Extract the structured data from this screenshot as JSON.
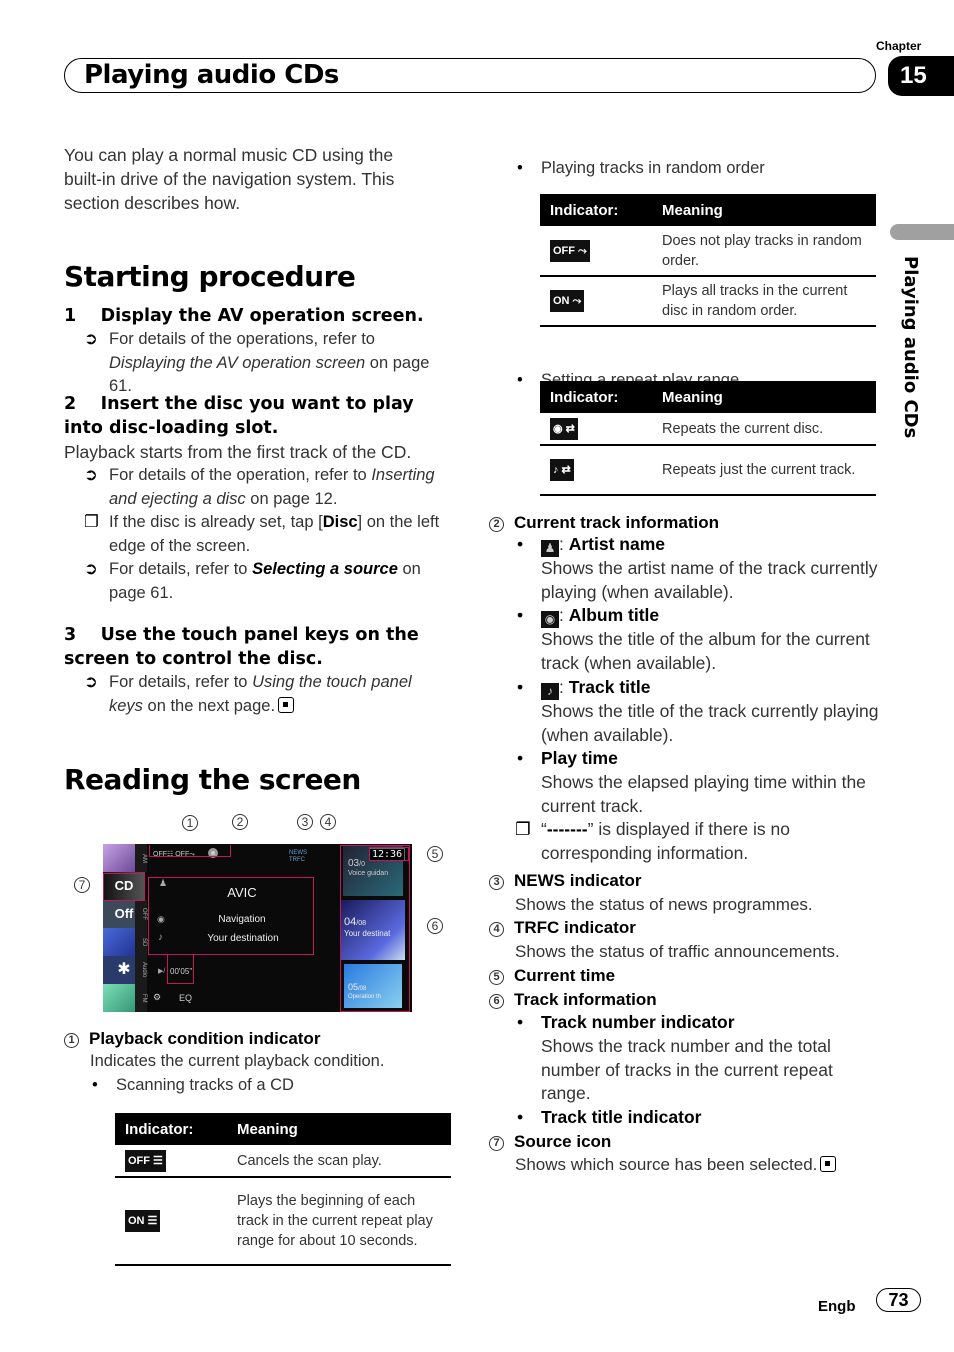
{
  "header": {
    "title": "Playing audio CDs",
    "chapter_label": "Chapter",
    "chapter_number": "15",
    "side_label": "Playing audio CDs"
  },
  "intro": "You can play a normal music CD using the built-in drive of the navigation system. This section describes how.",
  "starting": {
    "heading": "Starting procedure",
    "step1": {
      "num": "1",
      "title": "Display the AV operation screen.",
      "note1_pre": "For details of the operations, refer to ",
      "note1_link": "Displaying the AV operation screen",
      "note1_post": " on page 61."
    },
    "step2": {
      "num": "2",
      "title": "Insert the disc you want to play into disc-loading slot.",
      "body": "Playback starts from the first track of the CD.",
      "note1_pre": "For details of the operation, refer to ",
      "note1_link": "Inserting and ejecting a disc",
      "note1_post": " on page 12.",
      "note2_pre": "If the disc is already set, tap [",
      "note2_bold": "Disc",
      "note2_post": "] on the left edge of the screen.",
      "note3_pre": "For details, refer to ",
      "note3_bold": "Selecting a source",
      "note3_post": " on page 61."
    },
    "step3": {
      "num": "3",
      "title": "Use the touch panel keys on the screen to control the disc.",
      "note1_pre": "For details, refer to ",
      "note1_link": "Using the touch panel keys",
      "note1_post": " on the next page."
    }
  },
  "reading": {
    "heading": "Reading the screen",
    "screen": {
      "sources": [
        "AM",
        "CD",
        "OFF",
        "SD",
        "Audio",
        "FM"
      ],
      "source_off_label": "Off",
      "cd_label": "CD",
      "status_icons": "OFF☷ OFF⤳",
      "news": "NEWS",
      "trfc": "TRFC",
      "artist": "AVIC",
      "album": "Navigation",
      "track": "Your destination",
      "play_time": "00'05\"",
      "eq": "EQ",
      "clock": "12:36",
      "tracks": [
        {
          "num": "03",
          "total": "/0",
          "title": "Voice guidan"
        },
        {
          "num": "04",
          "total": "/08",
          "title": "Your destinat"
        },
        {
          "num": "05",
          "total": "/08",
          "title": "Operation th"
        }
      ],
      "callouts": [
        "1",
        "2",
        "3",
        "4",
        "5",
        "6",
        "7"
      ]
    },
    "item1": {
      "num": "1",
      "title": "Playback condition indicator",
      "desc": "Indicates the current playback condition.",
      "bullet": "Scanning tracks of a CD"
    },
    "scan_table": {
      "headers": [
        "Indicator:",
        "Meaning"
      ],
      "rows": [
        {
          "indicator": "OFF ☰",
          "meaning": "Cancels the scan play."
        },
        {
          "indicator": "ON ☰",
          "meaning": "Plays the beginning of each track in the current repeat play range for about 10 seconds."
        }
      ]
    },
    "random_bullet": "Playing tracks in random order",
    "random_table": {
      "headers": [
        "Indicator:",
        "Meaning"
      ],
      "rows": [
        {
          "indicator": "OFF ⤳",
          "meaning": "Does not play tracks in random order."
        },
        {
          "indicator": "ON ⤳",
          "meaning": "Plays all tracks in the current disc in random order."
        }
      ]
    },
    "repeat_bullet": "Setting a repeat play range",
    "repeat_table": {
      "headers": [
        "Indicator:",
        "Meaning"
      ],
      "rows": [
        {
          "indicator": "◉ ⇄",
          "meaning": "Repeats the current disc."
        },
        {
          "indicator": "♪ ⇄",
          "meaning": "Repeats just the current track."
        }
      ]
    },
    "item2": {
      "num": "2",
      "title": "Current track information",
      "artist_title": "Artist name",
      "artist_desc": "Shows the artist name of the track currently playing (when available).",
      "album_title": "Album title",
      "album_desc": "Shows the title of the album for the current track (when available).",
      "track_title": "Track title",
      "track_desc": "Shows the title of the track currently playing (when available).",
      "play_title": "Play time",
      "play_desc": "Shows the elapsed playing time within the current track.",
      "note_dash": "-------",
      "note_post": "” is displayed if there is no corresponding information.",
      "note_pre": "“"
    },
    "item3": {
      "num": "3",
      "title": "NEWS indicator",
      "desc": "Shows the status of news programmes."
    },
    "item4": {
      "num": "4",
      "title": "TRFC indicator",
      "desc": "Shows the status of traffic announcements."
    },
    "item5": {
      "num": "5",
      "title": "Current time"
    },
    "item6": {
      "num": "6",
      "title": "Track information",
      "b1_title": "Track number indicator",
      "b1_desc": "Shows the track number and the total number of tracks in the current repeat range.",
      "b2_title": "Track title indicator"
    },
    "item7": {
      "num": "7",
      "title": "Source icon",
      "desc": "Shows which source has been selected."
    }
  },
  "footer": {
    "lang": "Engb",
    "page": "73"
  }
}
